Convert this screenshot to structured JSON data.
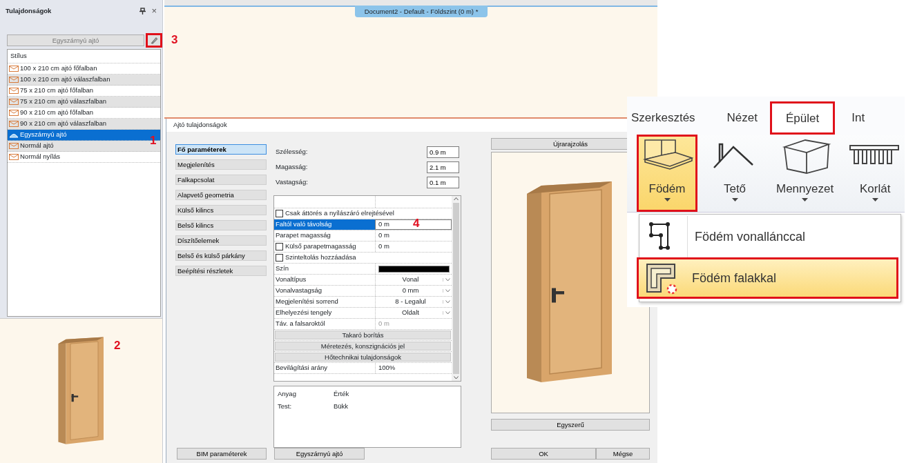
{
  "panel": {
    "title": "Tulajdonságok",
    "close": "×",
    "style_button": "Egyszárnyú ajtó",
    "edit_button": {
      "highlighted": true,
      "callout": "3"
    },
    "list_header": "Stílus",
    "styles": [
      {
        "label": "100 x 210 cm ajtó főfalban",
        "kind": "door",
        "selected": false
      },
      {
        "label": "100 x 210 cm ajtó válaszfalban",
        "kind": "door",
        "selected": false
      },
      {
        "label": "75 x 210 cm ajtó főfalban",
        "kind": "door",
        "selected": false
      },
      {
        "label": "75 x 210 cm ajtó válaszfalban",
        "kind": "door",
        "selected": false
      },
      {
        "label": "90 x 210 cm ajtó főfalban",
        "kind": "door",
        "selected": false
      },
      {
        "label": "90 x 210 cm ajtó válaszfalban",
        "kind": "door",
        "selected": false
      },
      {
        "label": "Egyszárnyú ajtó",
        "kind": "arch",
        "selected": true,
        "callout": "1"
      },
      {
        "label": "Normál ajtó",
        "kind": "door",
        "selected": false
      },
      {
        "label": "Normál nyílás",
        "kind": "door",
        "selected": false
      }
    ],
    "preview": {
      "callout": "2"
    }
  },
  "document": {
    "tab": "Document2 - Default - Földszint (0 m) *"
  },
  "dialog": {
    "title": "Ajtó tulajdonságok",
    "nav": [
      {
        "label": "Fő paraméterek",
        "selected": true
      },
      {
        "label": "Megjelenítés",
        "selected": false
      },
      {
        "label": "Falkapcsolat",
        "selected": false
      },
      {
        "label": "Alapvető geometria",
        "selected": false
      },
      {
        "label": "Külső kilincs",
        "selected": false
      },
      {
        "label": "Belső kilincs",
        "selected": false
      },
      {
        "label": "Díszítőelemek",
        "selected": false
      },
      {
        "label": "Belső és külső párkány",
        "selected": false
      },
      {
        "label": "Beépítési részletek",
        "selected": false
      }
    ],
    "fields": [
      {
        "label": "Szélesség:",
        "value": "0.9 m"
      },
      {
        "label": "Magasság:",
        "value": "2.1 m"
      },
      {
        "label": "Vastagság:",
        "value": "0.1 m"
      }
    ],
    "grid": [
      {
        "kind": "check",
        "label": "Csak áttörés a nyílászáró elrejtésével",
        "checked": false,
        "selected": false
      },
      {
        "kind": "value",
        "label": "Faltól való távolság",
        "value": "0 m",
        "selected": true,
        "callout": "4"
      },
      {
        "kind": "value",
        "label": "Parapet magasság",
        "value": "0 m",
        "selected": false
      },
      {
        "kind": "check",
        "label": "Külső parapetmagasság",
        "value": "0 m",
        "checked": false,
        "selected": false
      },
      {
        "kind": "check",
        "label": "Szinteltolás hozzáadása",
        "checked": false,
        "selected": false
      },
      {
        "kind": "color",
        "label": "Szín",
        "color": "#000000",
        "selected": false
      },
      {
        "kind": "select",
        "label": "Vonaltípus",
        "value": "Vonal",
        "selected": false
      },
      {
        "kind": "select",
        "label": "Vonalvastagság",
        "value": "0 mm",
        "selected": false
      },
      {
        "kind": "select",
        "label": "Megjelenítési sorrend",
        "value": "8 - Legalul",
        "selected": false
      },
      {
        "kind": "select",
        "label": "Elhelyezési tengely",
        "value": "Oldalt",
        "selected": false
      },
      {
        "kind": "value",
        "label": "Táv. a falsaroktól",
        "value": "0 m",
        "selected": false,
        "disabled": true
      },
      {
        "kind": "section",
        "label": "Takaró borítás",
        "selected": false
      },
      {
        "kind": "section",
        "label": "Méretezés, konszignációs jel",
        "selected": false
      },
      {
        "kind": "section",
        "label": "Hőtechnikai tulajdonságok",
        "selected": false
      },
      {
        "kind": "value",
        "label": "Bevilágítási arány",
        "value": "100%",
        "selected": false
      }
    ],
    "materials": {
      "columns": [
        "Anyag",
        "Érték"
      ],
      "rows": [
        [
          "Test:",
          "Bükk"
        ]
      ]
    },
    "redraw_button": "Újrarajzolás",
    "view_button": "Egyszerű",
    "footer_buttons": [
      "BIM paraméterek",
      "Egyszárnyú ajtó"
    ],
    "ok": "OK",
    "cancel": "Mégse"
  },
  "ribbon": {
    "tabs": [
      {
        "label": "Szerkesztés",
        "selected": false,
        "highlighted": false
      },
      {
        "label": "Nézet",
        "selected": false,
        "highlighted": false
      },
      {
        "label": "Épület",
        "selected": true,
        "highlighted": true
      },
      {
        "label": "Int",
        "selected": false,
        "highlighted": false
      }
    ],
    "tools": [
      {
        "label": "Födém",
        "kind": "slab",
        "selected": true,
        "highlighted": true
      },
      {
        "label": "Tető",
        "kind": "roof",
        "selected": false,
        "highlighted": false
      },
      {
        "label": "Mennyezet",
        "kind": "ceiling",
        "selected": false,
        "highlighted": false
      },
      {
        "label": "Korlát",
        "kind": "railing",
        "selected": false,
        "highlighted": false
      }
    ],
    "menu": [
      {
        "label": "Födém vonallánccal",
        "kind": "polyline",
        "selected": false,
        "highlighted": false
      },
      {
        "label": "Födém falakkal",
        "kind": "walls",
        "selected": true,
        "highlighted": true
      }
    ]
  }
}
